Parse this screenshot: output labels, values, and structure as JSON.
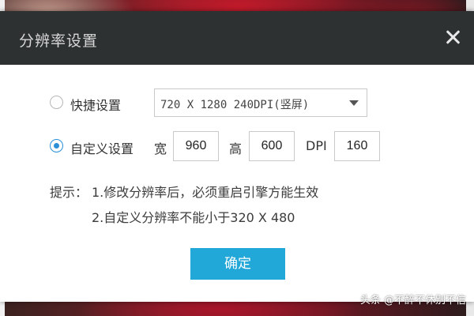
{
  "dialog": {
    "title": "分辨率设置",
    "quick": {
      "label": "快捷设置",
      "selected_option": "720 X 1280 240DPI(竖屏)",
      "checked": false
    },
    "custom": {
      "label": "自定义设置",
      "checked": true,
      "width_label": "宽",
      "width_value": "960",
      "height_label": "高",
      "height_value": "600",
      "dpi_label": "DPI",
      "dpi_value": "160"
    },
    "hint": {
      "prefix": "提示：",
      "line1": "1.修改分辨率后，必须重启引擎方能生效",
      "line2": "2.自定义分辨率不能小于320 X 480"
    },
    "confirm_label": "确定"
  },
  "watermark": "头条 @不醉不休别不信",
  "colors": {
    "titlebar": "#2e3132",
    "accent": "#22a7d9",
    "radio_checked": "#2a8fd6"
  },
  "icons": {
    "close": "close-icon",
    "dropdown": "chevron-down-icon"
  }
}
